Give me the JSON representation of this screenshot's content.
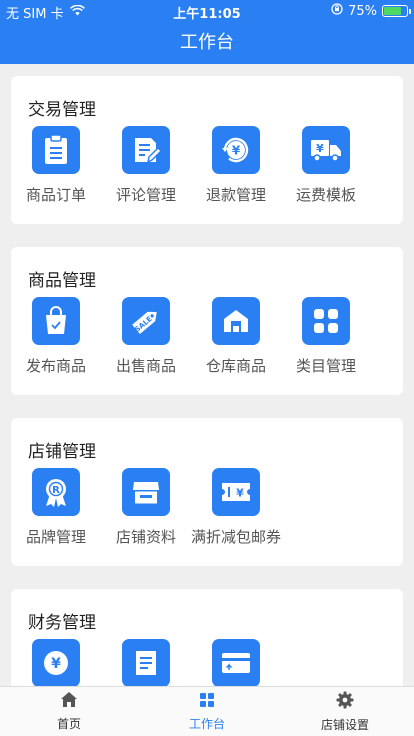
{
  "status_bar": {
    "carrier": "无 SIM 卡",
    "time": "上午11:05",
    "battery_percent": "75%",
    "battery_level": 0.75
  },
  "nav": {
    "title": "工作台"
  },
  "sections": [
    {
      "title": "交易管理",
      "items": [
        {
          "label": "商品订单",
          "icon": "clipboard-icon"
        },
        {
          "label": "评论管理",
          "icon": "edit-document-icon"
        },
        {
          "label": "退款管理",
          "icon": "refund-icon"
        },
        {
          "label": "运费模板",
          "icon": "delivery-truck-icon"
        }
      ]
    },
    {
      "title": "商品管理",
      "items": [
        {
          "label": "发布商品",
          "icon": "shopping-bag-icon"
        },
        {
          "label": "出售商品",
          "icon": "sale-tag-icon"
        },
        {
          "label": "仓库商品",
          "icon": "warehouse-icon"
        },
        {
          "label": "类目管理",
          "icon": "category-grid-icon"
        }
      ]
    },
    {
      "title": "店铺管理",
      "items": [
        {
          "label": "品牌管理",
          "icon": "brand-badge-icon"
        },
        {
          "label": "店铺资料",
          "icon": "store-icon"
        },
        {
          "label": "满折减包邮券",
          "icon": "coupon-icon"
        }
      ]
    },
    {
      "title": "财务管理",
      "items": [
        {
          "label": "",
          "icon": "yuan-coin-icon"
        },
        {
          "label": "",
          "icon": "statement-icon"
        },
        {
          "label": "",
          "icon": "bank-card-icon"
        }
      ]
    }
  ],
  "tabbar": [
    {
      "label": "首页",
      "icon": "home-icon",
      "active": false
    },
    {
      "label": "工作台",
      "icon": "workbench-grid-icon",
      "active": true
    },
    {
      "label": "店铺设置",
      "icon": "gear-icon",
      "active": false
    }
  ],
  "colors": {
    "brand": "#2a80f2",
    "background": "#efefef",
    "battery": "#4cd964"
  }
}
